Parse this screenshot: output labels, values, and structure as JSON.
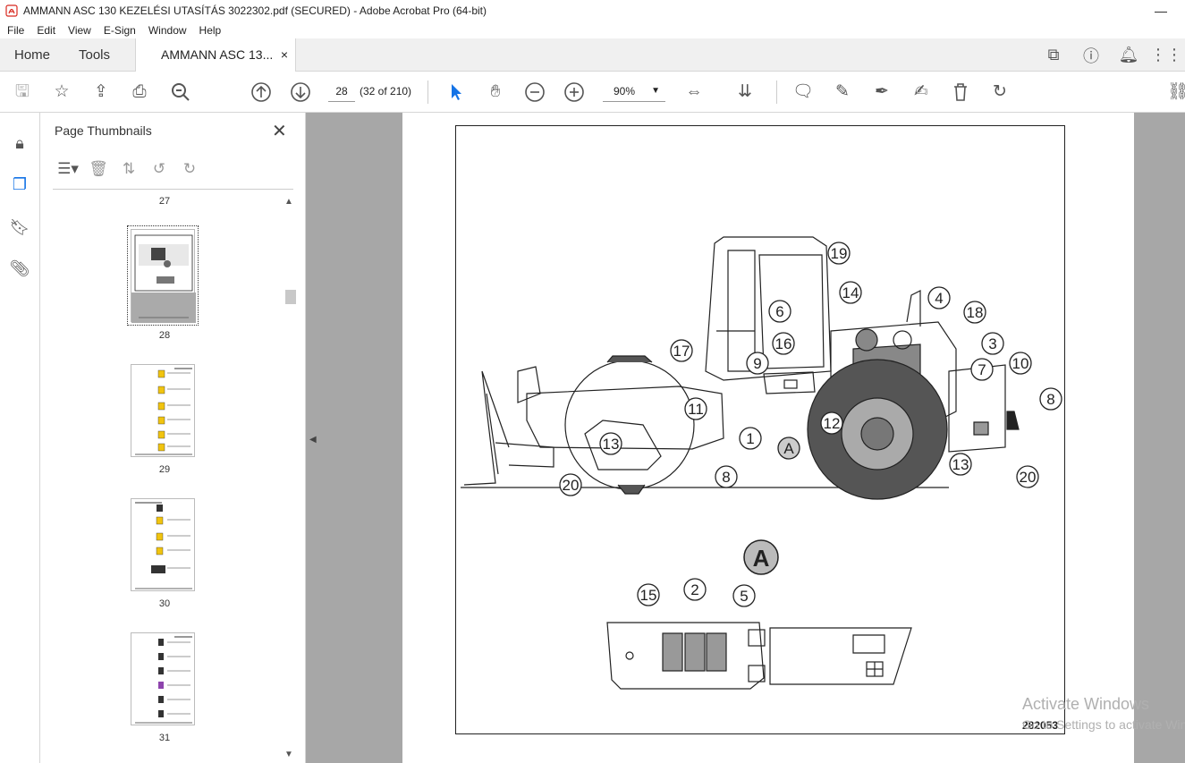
{
  "window": {
    "title": "AMMANN ASC 130 KEZELÉSI UTASÍTÁS 3022302.pdf (SECURED) - Adobe Acrobat Pro (64-bit)"
  },
  "menu": [
    "File",
    "Edit",
    "View",
    "E-Sign",
    "Window",
    "Help"
  ],
  "tabs": {
    "home": "Home",
    "tools": "Tools",
    "document": "AMMANN ASC 13...",
    "close": "×"
  },
  "toolbar": {
    "page_number": "28",
    "page_count": "(32 of 210)",
    "zoom": "90%"
  },
  "panel": {
    "title": "Page Thumbnails",
    "close": "✕",
    "pages": [
      {
        "label": "27"
      },
      {
        "label": "28",
        "selected": true
      },
      {
        "label": "29"
      },
      {
        "label": "30"
      },
      {
        "label": "31"
      }
    ]
  },
  "document": {
    "detail_label": "A",
    "drawing_code": "282053",
    "callouts_main": [
      "19",
      "14",
      "6",
      "16",
      "4",
      "18",
      "3",
      "17",
      "9",
      "7",
      "10",
      "11",
      "12",
      "8",
      "13",
      "1",
      "A",
      "13",
      "8",
      "20",
      "20"
    ],
    "callouts_detail": [
      "15",
      "2",
      "5"
    ]
  },
  "os_watermark": {
    "line1": "Activate Windows",
    "line2": "Go to Settings to activate Windows."
  }
}
